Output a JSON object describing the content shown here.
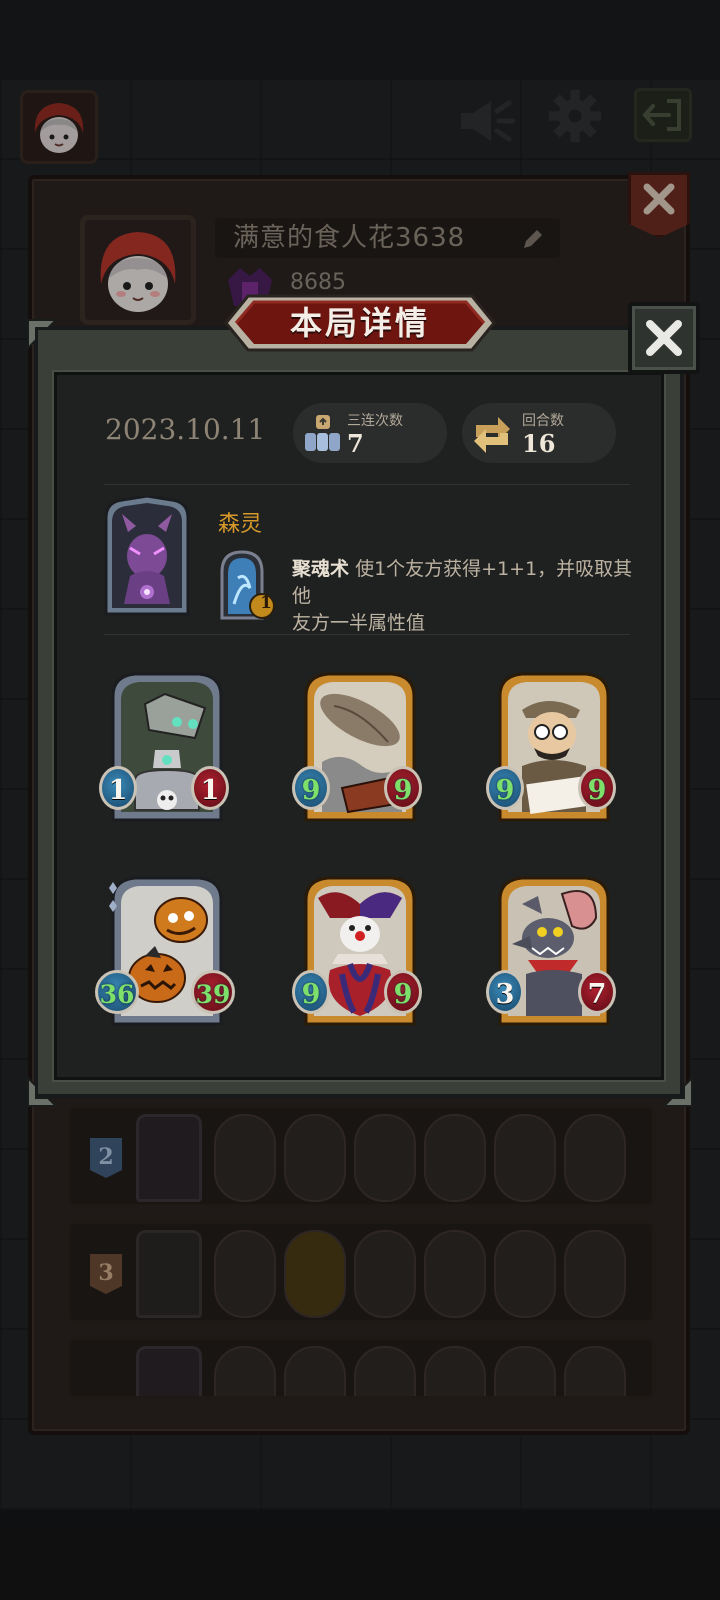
{
  "background": {
    "profile": {
      "player_name": "满意的食人花3638",
      "rating": "8685"
    },
    "history_rows": [
      {
        "rank": "2",
        "card_count": 6
      },
      {
        "rank": "3",
        "card_count": 6
      },
      {
        "rank": "",
        "card_count": 6
      }
    ]
  },
  "modal": {
    "title": "本局详情",
    "date": "2023.10.11",
    "stats": [
      {
        "label": "三连次数",
        "value": "7",
        "icon": "triple-units-icon"
      },
      {
        "label": "回合数",
        "value": "16",
        "icon": "rounds-arrows-icon"
      }
    ],
    "hero": {
      "name": "森灵",
      "skill_icon": "portal-icon",
      "skill_cost": "1",
      "skill_name": "聚魂术",
      "skill_desc_1": "使1个友方获得+1+1，并吸取其他",
      "skill_desc_2": "友方一半属性值"
    },
    "cards": [
      {
        "name": "robot-hat-card",
        "frame": "silver",
        "attack": "1",
        "health": "1",
        "buffed": false
      },
      {
        "name": "zeppelin-card",
        "frame": "gold",
        "attack": "9",
        "health": "9",
        "buffed": false
      },
      {
        "name": "inventor-card",
        "frame": "gold",
        "attack": "9",
        "health": "9",
        "buffed": false
      },
      {
        "name": "pumpkin-card",
        "frame": "silver",
        "attack": "36",
        "health": "39",
        "buffed": true
      },
      {
        "name": "jester-card",
        "frame": "gold",
        "attack": "9",
        "health": "9",
        "buffed": false
      },
      {
        "name": "wererat-card",
        "frame": "gold",
        "attack": "3",
        "health": "7",
        "buffed": false
      }
    ]
  },
  "colors": {
    "gold_frame": "#c98a2e",
    "silver_frame": "#6f7a8c",
    "hero_name": "#d79a2a",
    "buffed_stat": "#7de06a"
  }
}
